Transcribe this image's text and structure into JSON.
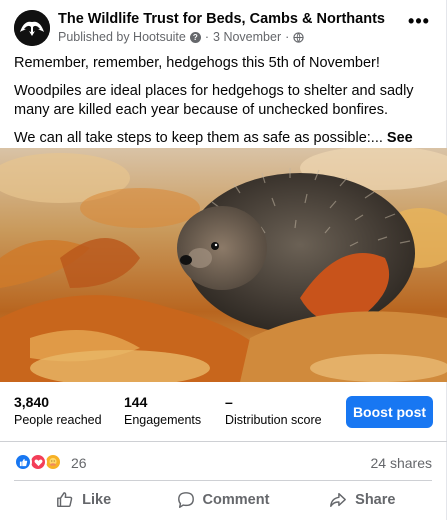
{
  "post": {
    "page_name": "The Wildlife Trust for Beds, Cambs & Northants",
    "published_by": "Published by Hootsuite",
    "date": "3 November",
    "separator": "·",
    "privacy_icon": "globe-icon",
    "more_label": "•••",
    "paragraphs": [
      "Remember, remember, hedgehogs this 5th of November!",
      "Woodpiles are ideal places for hedgehogs to shelter and sadly many are killed each year because of unchecked bonfires.",
      "We can all take steps to keep them as safe as possible:..."
    ],
    "see_more": "See more"
  },
  "insights": {
    "reach_value": "3,840",
    "reach_label": "People reached",
    "engagements_value": "144",
    "engagements_label": "Engagements",
    "distribution_value": "–",
    "distribution_label": "Distribution score",
    "boost_label": "Boost post"
  },
  "reactions": {
    "icons": [
      "like-reaction-icon",
      "love-reaction-icon",
      "care-reaction-icon"
    ],
    "count": "26",
    "shares": "24 shares"
  },
  "actions": {
    "like": "Like",
    "comment": "Comment",
    "share": "Share"
  },
  "colors": {
    "brand_blue": "#1877f2",
    "secondary_text": "#65676b",
    "divider": "#ced0d4"
  }
}
